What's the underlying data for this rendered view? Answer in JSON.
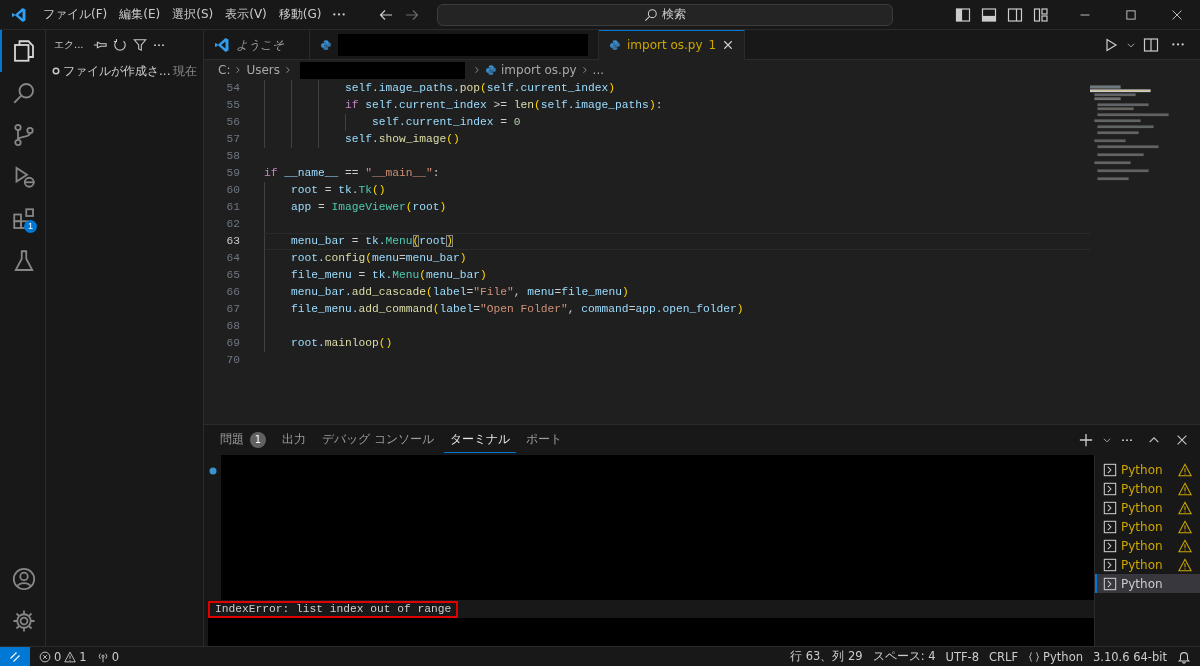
{
  "title_bar": {
    "menus": [
      "ファイル(F)",
      "編集(E)",
      "選択(S)",
      "表示(V)",
      "移動(G)"
    ],
    "search": {
      "placeholder": "検索"
    }
  },
  "activity_bar": {
    "items": [
      {
        "kind": "files",
        "selected": true
      },
      {
        "kind": "search",
        "selected": false
      },
      {
        "kind": "source-control",
        "selected": false
      },
      {
        "kind": "run",
        "selected": false
      },
      {
        "kind": "extensions",
        "selected": false,
        "badge": "1"
      },
      {
        "kind": "flask",
        "selected": false
      }
    ],
    "bottom": [
      {
        "kind": "account"
      },
      {
        "kind": "gear"
      }
    ]
  },
  "sidebar": {
    "title": "エク...",
    "items": [
      {
        "label": "ファイルが作成さ...",
        "detail": "現在"
      }
    ]
  },
  "tabs": [
    {
      "kind": "welcome",
      "label": "ようこそ",
      "selected": false
    },
    {
      "kind": "python",
      "redacted": true,
      "selected": false
    },
    {
      "kind": "python",
      "label": "import os.py",
      "problems": "1",
      "selected": true
    }
  ],
  "breadcrumbs": [
    {
      "label": "C:"
    },
    {
      "label": "Users"
    },
    {
      "redacted": true
    },
    {
      "label": "import os.py",
      "kind": "python"
    },
    {
      "label": "..."
    }
  ],
  "editor": {
    "lines": [
      {
        "number": "54",
        "current": false,
        "tokens": [
          {
            "text": "            self.image_paths.",
            "kind": "var"
          },
          {
            "text": "pop",
            "kind": "fn"
          },
          {
            "text": "(",
            "kind": "br"
          },
          {
            "text": "self.current_index",
            "kind": "var"
          },
          {
            "text": ")",
            "kind": "br"
          }
        ]
      },
      {
        "number": "55",
        "current": false,
        "tokens": [
          {
            "text": "            if",
            "kind": "kw"
          },
          {
            "text": " self.current_index ",
            "kind": "var"
          },
          {
            "text": ">= ",
            "kind": "op"
          },
          {
            "text": "len",
            "kind": "fn"
          },
          {
            "text": "(",
            "kind": "br"
          },
          {
            "text": "self.image_paths",
            "kind": "var"
          },
          {
            "text": ")",
            "kind": "br"
          },
          {
            "text": ":",
            "kind": "op"
          }
        ]
      },
      {
        "number": "56",
        "current": false,
        "tokens": [
          {
            "text": "                self.current_index",
            "kind": "var"
          },
          {
            "text": " = ",
            "kind": "op"
          },
          {
            "text": "0",
            "kind": "num"
          }
        ]
      },
      {
        "number": "57",
        "current": false,
        "tokens": [
          {
            "text": "            self.",
            "kind": "var"
          },
          {
            "text": "show_image",
            "kind": "fn"
          },
          {
            "text": "()",
            "kind": "br"
          }
        ]
      },
      {
        "number": "58",
        "current": false
      },
      {
        "number": "59",
        "current": false,
        "tokens": [
          {
            "text": "if",
            "kind": "kw"
          },
          {
            "text": " __name__",
            "kind": "var"
          },
          {
            "text": " == ",
            "kind": "op"
          },
          {
            "text": "\"__main__\"",
            "kind": "str"
          },
          {
            "text": ":",
            "kind": "op"
          }
        ]
      },
      {
        "number": "60",
        "current": false,
        "tokens": [
          {
            "text": "    root",
            "kind": "var"
          },
          {
            "text": " = ",
            "kind": "op"
          },
          {
            "text": "tk.",
            "kind": "var"
          },
          {
            "text": "Tk",
            "kind": "cls"
          },
          {
            "text": "()",
            "kind": "br"
          }
        ]
      },
      {
        "number": "61",
        "current": false,
        "tokens": [
          {
            "text": "    app",
            "kind": "var"
          },
          {
            "text": " = ",
            "kind": "op"
          },
          {
            "text": "ImageViewer",
            "kind": "cls"
          },
          {
            "text": "(",
            "kind": "br"
          },
          {
            "text": "root",
            "kind": "var"
          },
          {
            "text": ")",
            "kind": "br"
          }
        ]
      },
      {
        "number": "62",
        "current": false
      },
      {
        "number": "63",
        "current": true,
        "tokens": [
          {
            "text": "    menu_bar",
            "kind": "var"
          },
          {
            "text": " = ",
            "kind": "op"
          },
          {
            "text": "tk.",
            "kind": "var"
          },
          {
            "text": "Menu",
            "kind": "cls"
          },
          {
            "text": "(",
            "kind": "br-match"
          },
          {
            "text": "root",
            "kind": "var"
          },
          {
            "text": ")",
            "kind": "br-match"
          }
        ]
      },
      {
        "number": "64",
        "current": false,
        "tokens": [
          {
            "text": "    root.",
            "kind": "var"
          },
          {
            "text": "config",
            "kind": "fn"
          },
          {
            "text": "(",
            "kind": "br"
          },
          {
            "text": "menu",
            "kind": "var"
          },
          {
            "text": "=",
            "kind": "op"
          },
          {
            "text": "menu_bar",
            "kind": "var"
          },
          {
            "text": ")",
            "kind": "br"
          }
        ]
      },
      {
        "number": "65",
        "current": false,
        "tokens": [
          {
            "text": "    file_menu",
            "kind": "var"
          },
          {
            "text": " = ",
            "kind": "op"
          },
          {
            "text": "tk.",
            "kind": "var"
          },
          {
            "text": "Menu",
            "kind": "cls"
          },
          {
            "text": "(",
            "kind": "br"
          },
          {
            "text": "menu_bar",
            "kind": "var"
          },
          {
            "text": ")",
            "kind": "br"
          }
        ]
      },
      {
        "number": "66",
        "current": false,
        "tokens": [
          {
            "text": "    menu_bar.",
            "kind": "var"
          },
          {
            "text": "add_cascade",
            "kind": "fn"
          },
          {
            "text": "(",
            "kind": "br"
          },
          {
            "text": "label",
            "kind": "var"
          },
          {
            "text": "=",
            "kind": "op"
          },
          {
            "text": "\"File\"",
            "kind": "str"
          },
          {
            "text": ", ",
            "kind": "op"
          },
          {
            "text": "menu",
            "kind": "var"
          },
          {
            "text": "=",
            "kind": "op"
          },
          {
            "text": "file_menu",
            "kind": "var"
          },
          {
            "text": ")",
            "kind": "br"
          }
        ]
      },
      {
        "number": "67",
        "current": false,
        "tokens": [
          {
            "text": "    file_menu.",
            "kind": "var"
          },
          {
            "text": "add_command",
            "kind": "fn"
          },
          {
            "text": "(",
            "kind": "br"
          },
          {
            "text": "label",
            "kind": "var"
          },
          {
            "text": "=",
            "kind": "op"
          },
          {
            "text": "\"Open Folder\"",
            "kind": "str"
          },
          {
            "text": ", ",
            "kind": "op"
          },
          {
            "text": "command",
            "kind": "var"
          },
          {
            "text": "=",
            "kind": "op"
          },
          {
            "text": "app.open_folder",
            "kind": "var"
          },
          {
            "text": ")",
            "kind": "br"
          }
        ]
      },
      {
        "number": "68",
        "current": false
      },
      {
        "number": "69",
        "current": false,
        "tokens": [
          {
            "text": "    root.",
            "kind": "var"
          },
          {
            "text": "mainloop",
            "kind": "fn"
          },
          {
            "text": "()",
            "kind": "br"
          }
        ]
      },
      {
        "number": "70",
        "current": false
      }
    ]
  },
  "panel": {
    "tabs": [
      {
        "label": "問題",
        "badge": "1",
        "selected": false
      },
      {
        "label": "出力",
        "selected": false
      },
      {
        "label": "デバッグ コンソール",
        "selected": false
      },
      {
        "label": "ターミナル",
        "selected": true
      },
      {
        "label": "ポート",
        "selected": false
      }
    ],
    "terminal": {
      "output": "IndexError: list index out of range"
    },
    "terminals": [
      {
        "label": "Python",
        "warning": true,
        "selected": false
      },
      {
        "label": "Python",
        "warning": true,
        "selected": false
      },
      {
        "label": "Python",
        "warning": true,
        "selected": false
      },
      {
        "label": "Python",
        "warning": true,
        "selected": false
      },
      {
        "label": "Python",
        "warning": true,
        "selected": false
      },
      {
        "label": "Python",
        "warning": true,
        "selected": false
      },
      {
        "label": "Python",
        "warning": false,
        "selected": true
      }
    ]
  },
  "status_bar": {
    "errors": "0",
    "warnings": "1",
    "ports": "0",
    "position": "行 63、列 29",
    "indent": "スペース: 4",
    "encoding": "UTF-8",
    "eol": "CRLF",
    "language": "Python",
    "interpreter": "3.10.6 64-bit"
  }
}
